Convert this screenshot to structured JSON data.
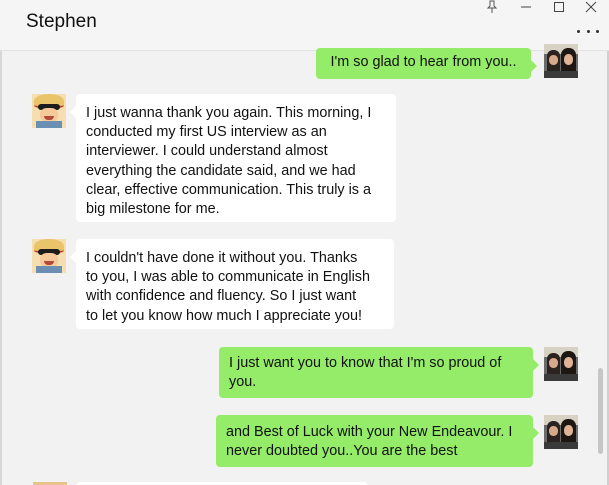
{
  "window": {
    "title": "Stephen",
    "pin_icon": "pin-icon",
    "minimize_icon": "minimize-icon",
    "maximize_icon": "maximize-icon",
    "close_icon": "close-icon",
    "more_icon": "more-options-icon"
  },
  "colors": {
    "outgoing_bubble": "#95ec69",
    "incoming_bubble": "#ffffff",
    "background": "#f2f2f2"
  },
  "messages": [
    {
      "direction": "out",
      "avatar": "couple-avatar",
      "text": "I'm so glad to hear from you.."
    },
    {
      "direction": "in",
      "avatar": "luffy-avatar",
      "lines": [
        "I just wanna thank you again. This morning, I",
        "conducted my first US interview as an",
        "interviewer. I could understand almost",
        "everything the candidate said, and we had",
        "clear, effective communication. This truly is a",
        "big milestone for me."
      ]
    },
    {
      "direction": "in",
      "avatar": "luffy-avatar",
      "lines": [
        "I couldn't have done it without you. Thanks",
        "to you, I was able to communicate in English",
        "with confidence and fluency. So I just want",
        "to let you know how much I appreciate you!"
      ]
    },
    {
      "direction": "out",
      "avatar": "couple-avatar",
      "lines": [
        "I just want you to know that I'm so proud of",
        "you."
      ]
    },
    {
      "direction": "out",
      "avatar": "couple-avatar",
      "lines": [
        "and Best of Luck with your New Endeavour. I",
        "never doubted you..You are the best"
      ]
    }
  ]
}
